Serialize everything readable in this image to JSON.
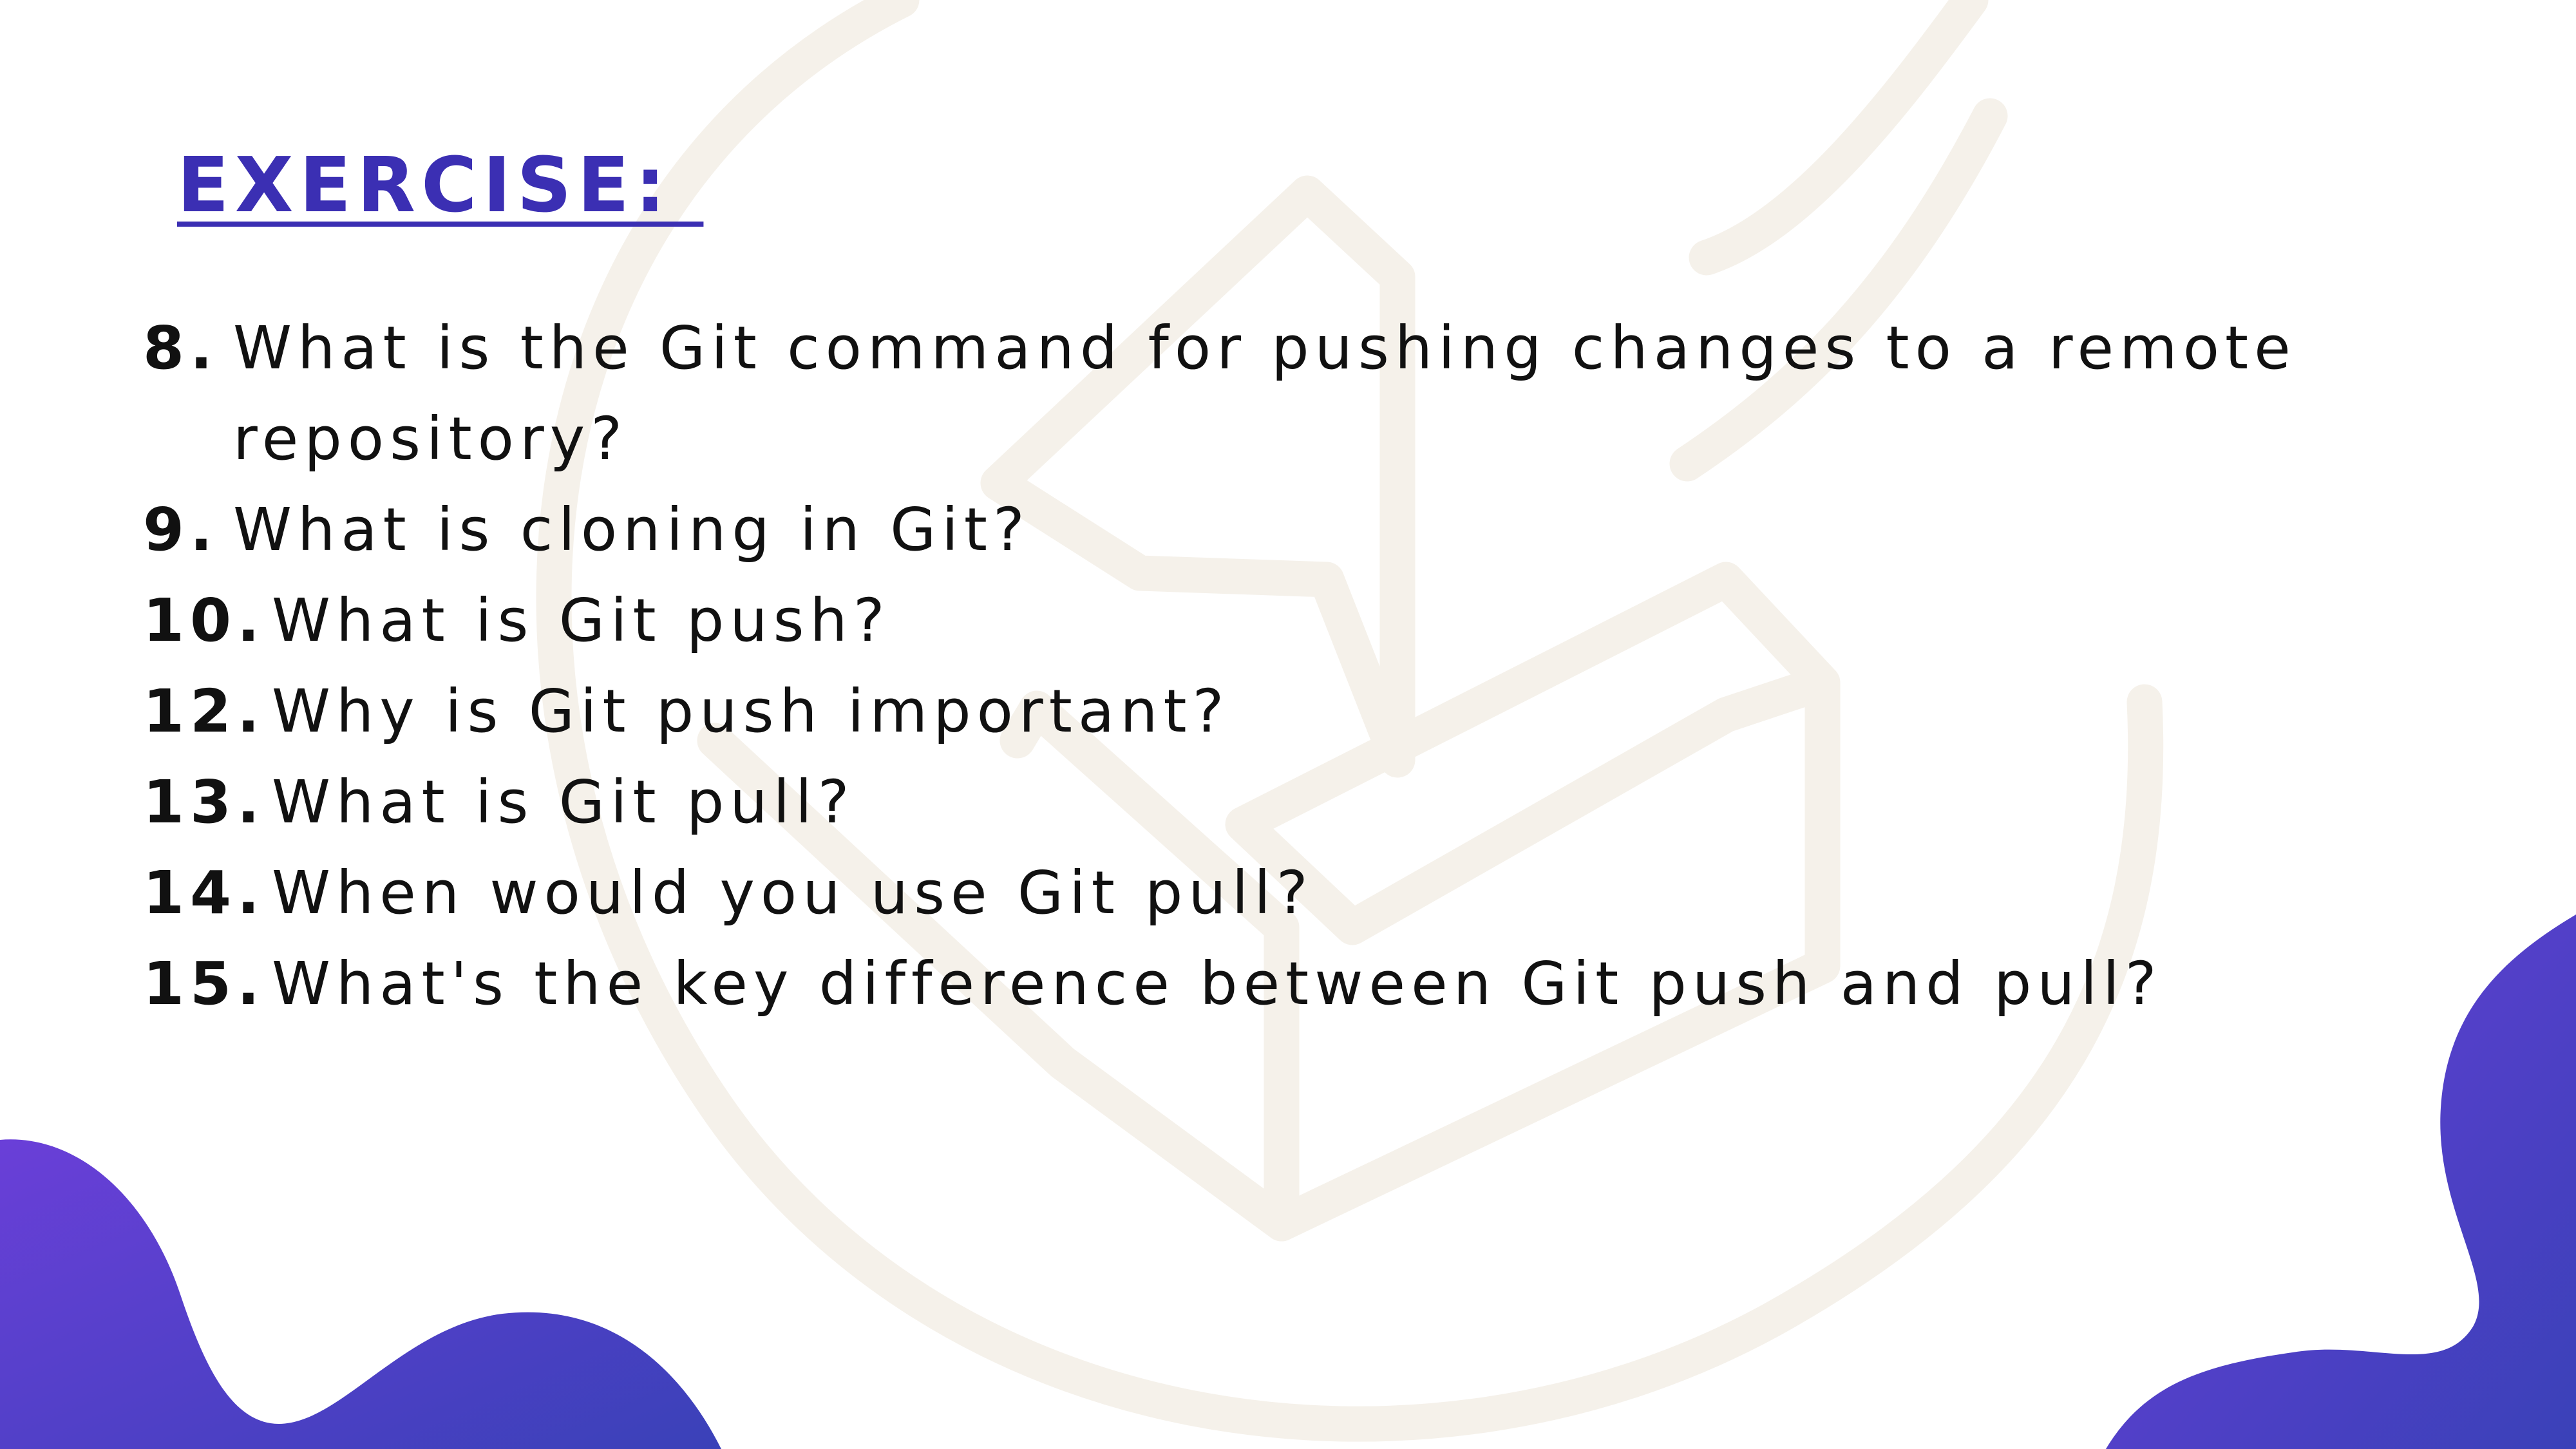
{
  "title": "EXERCISE: ",
  "questions": [
    {
      "number": "8.",
      "text": "What is the Git command for pushing changes to a remote repository?"
    },
    {
      "number": "9.",
      "text": "What is cloning in Git?"
    },
    {
      "number": "10.",
      "text": "What is Git push?"
    },
    {
      "number": "12.",
      "text": "Why is Git push important?"
    },
    {
      "number": "13.",
      "text": "What is Git pull?"
    },
    {
      "number": "14.",
      "text": "When would you use Git pull?"
    },
    {
      "number": "15.",
      "text": "What's the key difference between Git push and pull?"
    }
  ],
  "colors": {
    "title": "#3b2fb3",
    "text": "#111111",
    "blob_start": "#6a3fd8",
    "blob_end": "#3a41b8",
    "watermark": "#f5f1ea"
  }
}
